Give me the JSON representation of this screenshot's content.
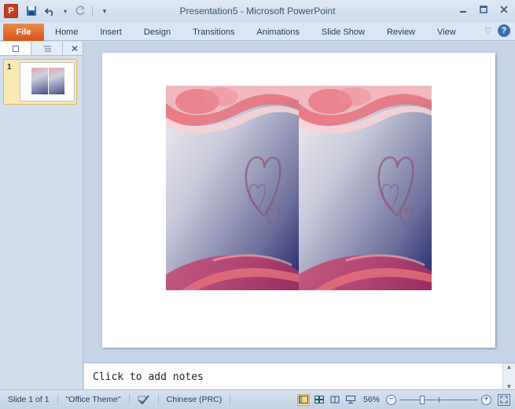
{
  "app": {
    "logo_letter": "P",
    "window_title": "Presentation5  -  Microsoft PowerPoint"
  },
  "ribbon": {
    "file_label": "File",
    "tabs": [
      "Home",
      "Insert",
      "Design",
      "Transitions",
      "Animations",
      "Slide Show",
      "Review",
      "View"
    ]
  },
  "slides_panel": {
    "thumbnail_number": "1"
  },
  "notes": {
    "placeholder": "Click to add notes"
  },
  "statusbar": {
    "slide_info": "Slide 1 of 1",
    "theme": "\"Office Theme\"",
    "language": "Chinese (PRC)",
    "zoom_level": "56%",
    "zoom_fraction": 0.28
  },
  "colors": {
    "file_tab": "#d4561b",
    "accent": "#2c4f7f",
    "card_pink": "#e8707a",
    "card_navy": "#1f2366"
  },
  "icons": {
    "save": "save-icon",
    "undo": "undo-icon",
    "redo": "redo-icon",
    "customize": "customize-qat-icon",
    "minimize": "minimize-icon",
    "restore": "restore-icon",
    "close": "close-icon",
    "collapse": "collapse-ribbon-icon",
    "help": "help-icon"
  }
}
